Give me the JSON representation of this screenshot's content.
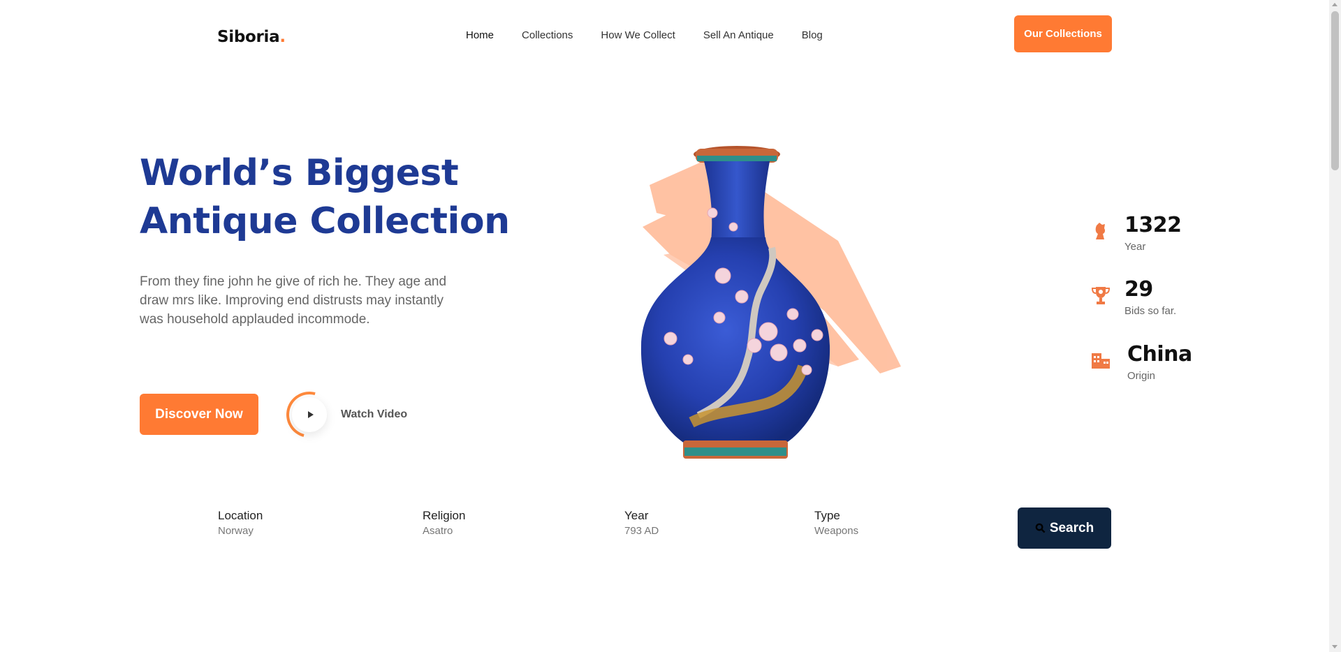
{
  "header": {
    "logo_text": "Siboria",
    "logo_dot": ".",
    "nav": [
      {
        "label": "Home"
      },
      {
        "label": "Collections"
      },
      {
        "label": "How We Collect"
      },
      {
        "label": "Sell An Antique"
      },
      {
        "label": "Blog"
      }
    ],
    "cta_label": "Our Collections"
  },
  "hero": {
    "title_line1": "World’s Biggest",
    "title_line2": "Antique Collection",
    "description": "From they fine john he give of rich he. They age and draw mrs like. Improving end distrusts may instantly was household applauded incommode.",
    "discover_label": "Discover Now",
    "watch_label": "Watch Video"
  },
  "stats": [
    {
      "value": "1322",
      "label": "Year",
      "icon": "bust-icon"
    },
    {
      "value": "29",
      "label": "Bids so far.",
      "icon": "trophy-icon"
    },
    {
      "value": "China",
      "label": "Origin",
      "icon": "building-icon"
    }
  ],
  "filters": [
    {
      "title": "Location",
      "value": "Norway"
    },
    {
      "title": "Religion",
      "value": "Asatro"
    },
    {
      "title": "Year",
      "value": "793 AD"
    },
    {
      "title": "Type",
      "value": "Weapons"
    }
  ],
  "search_label": "Search",
  "colors": {
    "accent": "#ff7a33",
    "title_blue": "#1e3a94",
    "dark_navy": "#0f2540",
    "brush": "#ffbf9f"
  }
}
